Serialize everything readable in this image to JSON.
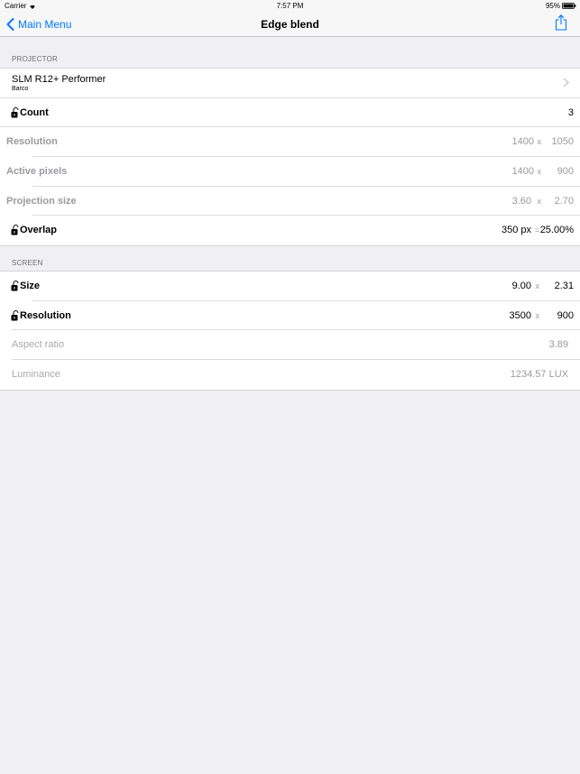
{
  "status_bar": {
    "carrier": "Carrier",
    "time": "7:57 PM",
    "battery": "95%"
  },
  "nav": {
    "back_label": "Main Menu",
    "title": "Edge blend",
    "accent_color": "#007aff"
  },
  "projector_section": {
    "header": "PROJECTOR",
    "model": "SLM R12+ Performer",
    "vendor": "Barco",
    "count_label": "Count",
    "count_value": "3",
    "resolution_label": "Resolution",
    "resolution_w": "1400",
    "resolution_h": "1050",
    "active_pixels_label": "Active pixels",
    "active_pixels_w": "1400",
    "active_pixels_h": "900",
    "projection_size_label": "Projection size",
    "projection_size_w": "3.60",
    "projection_size_h": "2.70",
    "overlap_label": "Overlap",
    "overlap_px": "350 px",
    "overlap_eq": "=",
    "overlap_percent": "25.00%"
  },
  "screen_section": {
    "header": "SCREEN",
    "size_label": "Size",
    "size_w": "9.00",
    "size_h": "2.31",
    "resolution_label": "Resolution",
    "resolution_w": "3500",
    "resolution_h": "900",
    "aspect_label": "Aspect ratio",
    "aspect_value": "3.89",
    "luminance_label": "Luminance",
    "luminance_value": "1234.57 LUX"
  },
  "times_symbol": "x"
}
